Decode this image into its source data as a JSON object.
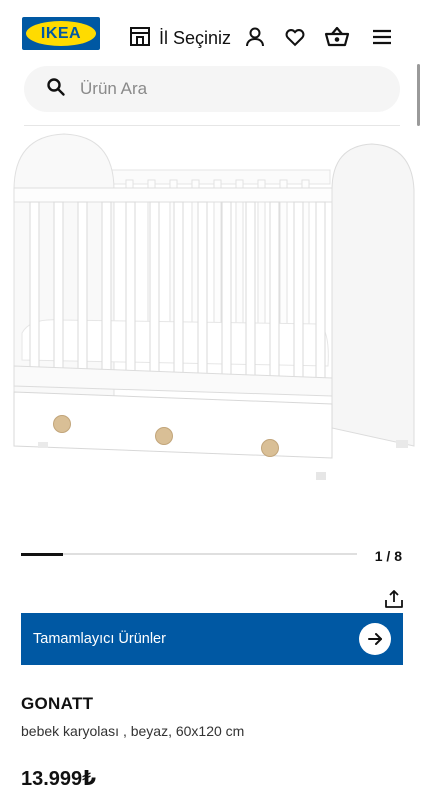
{
  "brand": {
    "logo_text": "IKEA",
    "blue": "#0058a3",
    "yellow": "#ffdb00"
  },
  "header": {
    "store_label": "İl Seçiniz",
    "icons": [
      "store-icon",
      "user-icon",
      "heart-icon",
      "basket-icon",
      "menu-icon"
    ]
  },
  "search": {
    "placeholder": "Ürün Ara",
    "icon": "search-icon"
  },
  "gallery": {
    "current": 1,
    "total": 8,
    "indicator": "1 / 8",
    "progress": 0.125
  },
  "share": {
    "icon": "share-icon"
  },
  "complementary": {
    "label": "Tamamlayıcı Ürünler",
    "icon": "arrow-right-icon"
  },
  "product": {
    "name": "GONATT",
    "description": "bebek karyolası , beyaz, 60x120 cm",
    "price": "13.999₺"
  }
}
